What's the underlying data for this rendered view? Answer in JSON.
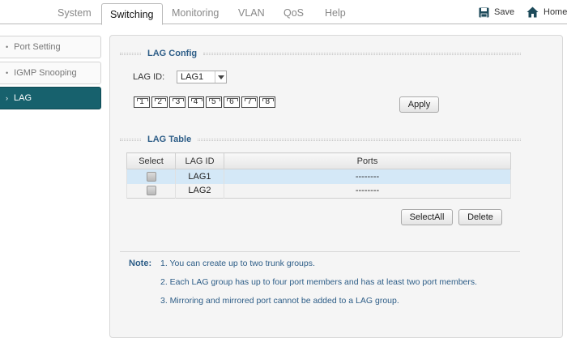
{
  "top_tabs": [
    {
      "label": "System"
    },
    {
      "label": "Switching",
      "active": true
    },
    {
      "label": "Monitoring"
    },
    {
      "label": "VLAN"
    },
    {
      "label": "QoS"
    },
    {
      "label": "Help"
    }
  ],
  "top_actions": {
    "save_label": "Save",
    "save_icon": "floppy-disk-icon",
    "home_label": "Home",
    "home_icon": "house-icon"
  },
  "sidebar": {
    "items": [
      {
        "label": "Port Setting",
        "bullet": "•"
      },
      {
        "label": "IGMP Snooping",
        "bullet": "•"
      },
      {
        "label": "LAG",
        "bullet": "›",
        "active": true
      }
    ]
  },
  "lag_config": {
    "title": "LAG Config",
    "lag_id_label": "LAG ID:",
    "lag_id_value": "LAG1",
    "ports": [
      "1",
      "2",
      "3",
      "4",
      "5",
      "6",
      "7",
      "8"
    ],
    "apply_label": "Apply"
  },
  "lag_table": {
    "title": "LAG Table",
    "columns": [
      "Select",
      "LAG ID",
      "Ports"
    ],
    "rows": [
      {
        "lag_id": "LAG1",
        "ports": "--------",
        "selected_row": true
      },
      {
        "lag_id": "LAG2",
        "ports": "--------",
        "selected_row": false
      }
    ],
    "select_all_label": "SelectAll",
    "delete_label": "Delete"
  },
  "note": {
    "label": "Note:",
    "lines": [
      "1. You can create up to two trunk groups.",
      "2. Each LAG group has up to four port members and has at least two port members.",
      "3. Mirroring and mirrored port cannot be added to a LAG group."
    ]
  },
  "colors": {
    "accent": "#17616d",
    "section_title": "#2d5d87",
    "row_highlight": "#d4e8f7"
  }
}
